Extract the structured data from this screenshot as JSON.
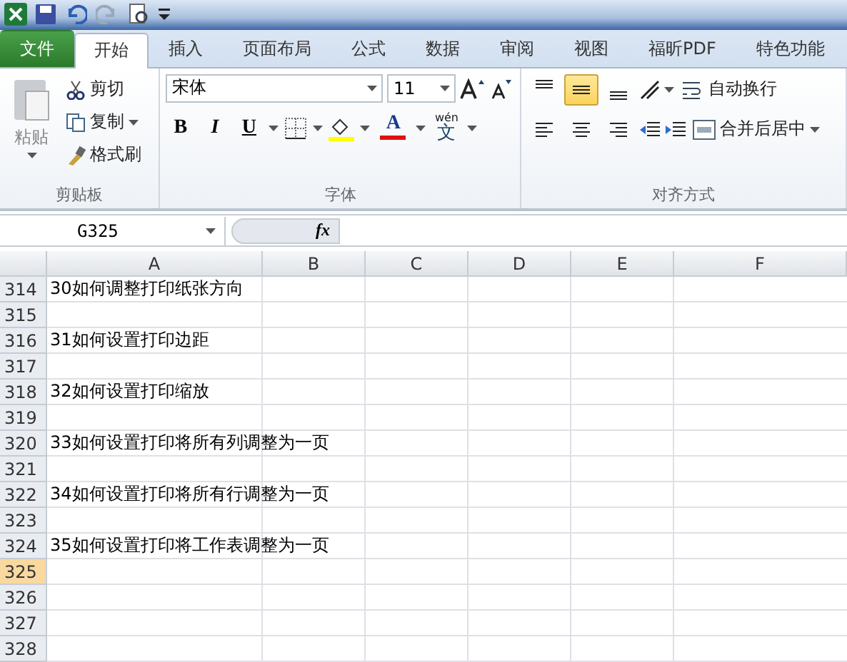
{
  "tabs": [
    {
      "label": "文件",
      "kind": "file",
      "selected": false
    },
    {
      "label": "开始",
      "kind": "tab",
      "selected": true
    },
    {
      "label": "插入",
      "kind": "tab",
      "selected": false
    },
    {
      "label": "页面布局",
      "kind": "tab",
      "selected": false
    },
    {
      "label": "公式",
      "kind": "tab",
      "selected": false
    },
    {
      "label": "数据",
      "kind": "tab",
      "selected": false
    },
    {
      "label": "审阅",
      "kind": "tab",
      "selected": false
    },
    {
      "label": "视图",
      "kind": "tab",
      "selected": false
    },
    {
      "label": "福昕PDF",
      "kind": "tab",
      "selected": false
    },
    {
      "label": "特色功能",
      "kind": "tab",
      "selected": false
    }
  ],
  "clipboard": {
    "paste": "粘贴",
    "cut": "剪切",
    "copy": "复制",
    "format_painter": "格式刷",
    "group_label": "剪贴板"
  },
  "font": {
    "name": "宋体",
    "size": "11",
    "bold": "B",
    "italic": "I",
    "underline": "U",
    "font_color_letter": "A",
    "phonetic_top": "wén",
    "phonetic_char": "文",
    "group_label": "字体"
  },
  "alignment": {
    "vertical": [
      {
        "kind": "top",
        "selected": false
      },
      {
        "kind": "middle",
        "selected": true
      },
      {
        "kind": "bottom",
        "selected": false
      }
    ],
    "wrap_text": "自动换行",
    "merge_center": "合并后居中",
    "group_label": "对齐方式"
  },
  "formula_bar": {
    "name_box": "G325",
    "fx": "fx"
  },
  "sheet": {
    "columns": [
      "A",
      "B",
      "C",
      "D",
      "E",
      "F"
    ],
    "rows": [
      {
        "number": "314",
        "a": "30如何调整打印纸张方向",
        "selected": false
      },
      {
        "number": "315",
        "selected": false
      },
      {
        "number": "316",
        "a": "31如何设置打印边距",
        "selected": false
      },
      {
        "number": "317",
        "selected": false
      },
      {
        "number": "318",
        "a": "32如何设置打印缩放",
        "selected": false
      },
      {
        "number": "319",
        "selected": false
      },
      {
        "number": "320",
        "a": "33如何设置打印将所有列调整为一页",
        "selected": false
      },
      {
        "number": "321",
        "selected": false
      },
      {
        "number": "322",
        "a": "34如何设置打印将所有行调整为一页",
        "selected": false
      },
      {
        "number": "323",
        "selected": false
      },
      {
        "number": "324",
        "a": "35如何设置打印将工作表调整为一页",
        "selected": false
      },
      {
        "number": "325",
        "selected": true
      },
      {
        "number": "326",
        "selected": false
      },
      {
        "number": "327",
        "selected": false
      },
      {
        "number": "328",
        "selected": false
      }
    ]
  }
}
